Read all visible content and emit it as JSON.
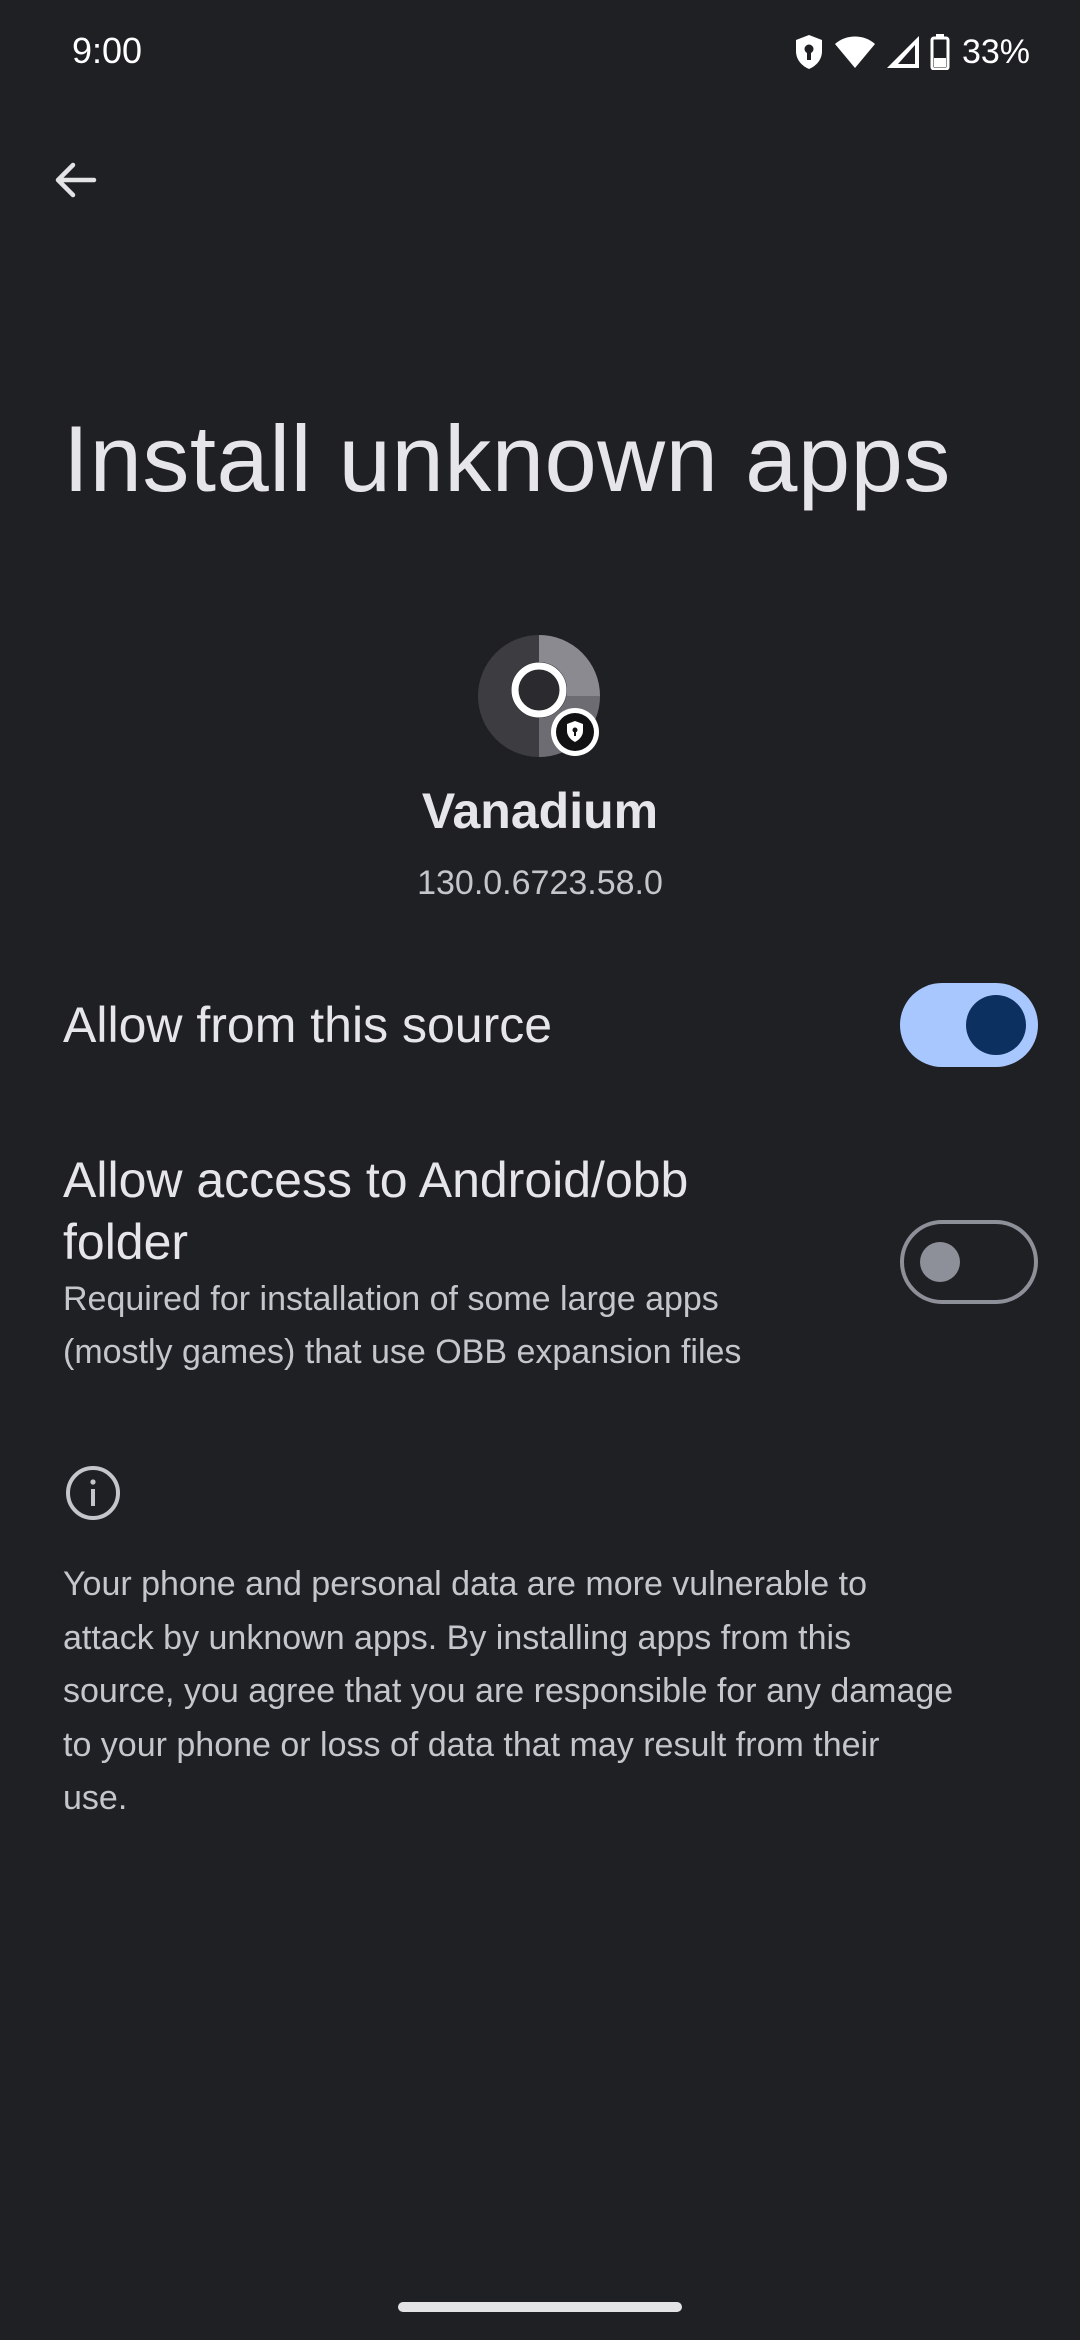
{
  "status_bar": {
    "time": "9:00",
    "battery_percent": "33%",
    "icons": [
      "vpn-shield-icon",
      "wifi-icon",
      "cell-signal-icon",
      "battery-icon"
    ]
  },
  "header": {
    "back_icon": "arrow-back-icon",
    "title": "Install unknown apps"
  },
  "app": {
    "icon": "vanadium-app-icon",
    "name": "Vanadium",
    "version": "130.0.6723.58.0"
  },
  "preferences": [
    {
      "title": "Allow from this source",
      "summary": "",
      "enabled": true
    },
    {
      "title_line1": "Allow access to Android/obb",
      "title_line2": "folder",
      "summary_line1": "Required for installation of some large apps",
      "summary_line2": "(mostly games) that use OBB expansion files",
      "enabled": false
    }
  ],
  "footer": {
    "info_icon": "info-icon",
    "warning_lines": [
      "Your phone and personal data are more vulnerable to",
      "attack by unknown apps. By installing apps from this",
      "source, you agree that you are responsible for any damage",
      "to your phone or loss of data that may result from their",
      "use."
    ]
  },
  "colors": {
    "background": "#1f2024",
    "switch_on_track": "#a9c7ff",
    "switch_on_thumb": "#0c305f",
    "switch_off_outline": "#8e9099"
  }
}
